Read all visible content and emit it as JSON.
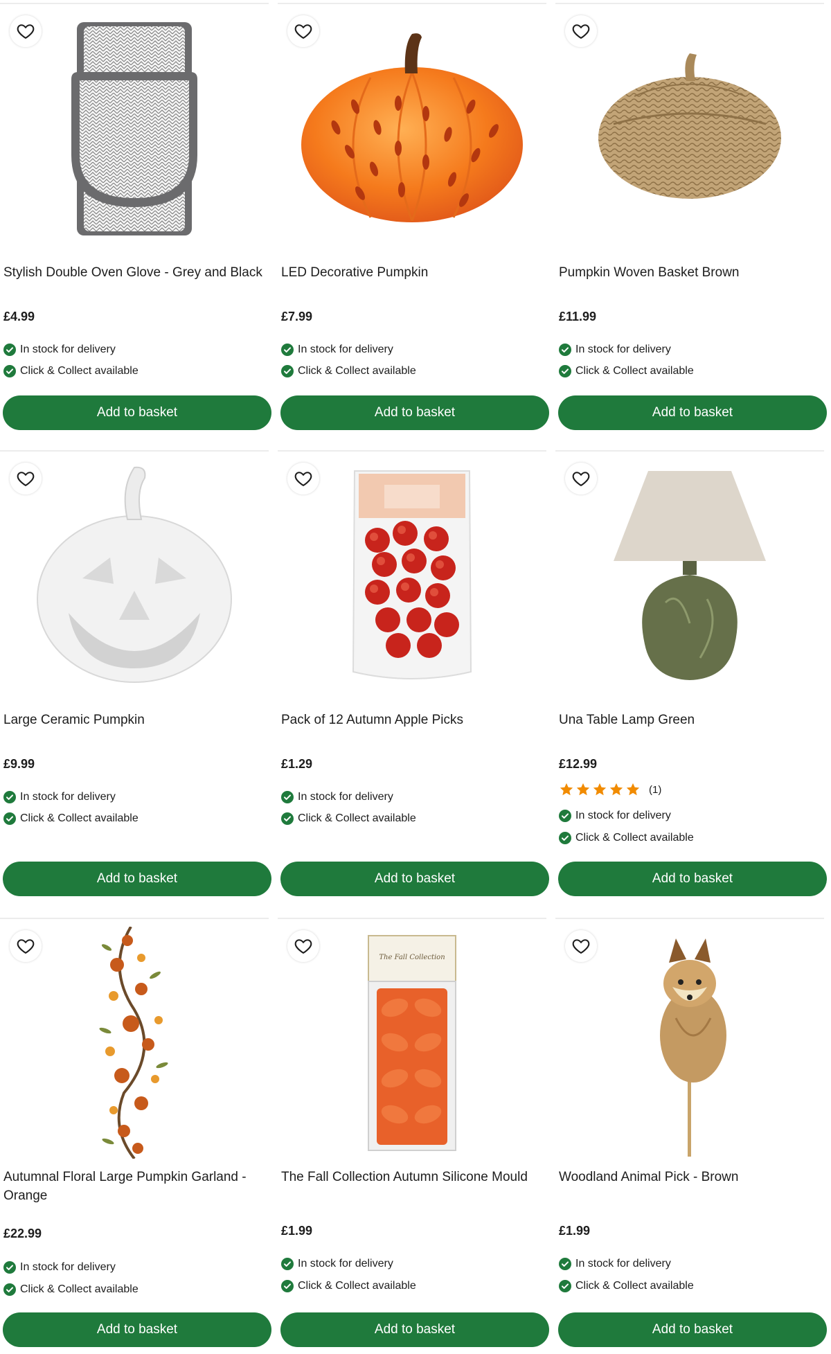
{
  "colors": {
    "accent": "#1f7a3c",
    "star": "#f18b00"
  },
  "icons": {
    "wishlist": "heart-outline-icon",
    "availability": "check-circle-icon",
    "rating": "star-icon"
  },
  "products": [
    {
      "title": "Stylish Double Oven Glove - Grey and Black",
      "price": "£4.99",
      "delivery": "In stock for delivery",
      "collect": "Click & Collect available",
      "button": "Add to basket"
    },
    {
      "title": "LED Decorative Pumpkin",
      "price": "£7.99",
      "delivery": "In stock for delivery",
      "collect": "Click & Collect available",
      "button": "Add to basket"
    },
    {
      "title": "Pumpkin Woven Basket Brown",
      "price": "£11.99",
      "delivery": "In stock for delivery",
      "collect": "Click & Collect available",
      "button": "Add to basket"
    },
    {
      "title": "Large Ceramic Pumpkin",
      "price": "£9.99",
      "delivery": "In stock for delivery",
      "collect": "Click & Collect available",
      "button": "Add to basket"
    },
    {
      "title": "Pack of 12 Autumn Apple Picks",
      "price": "£1.29",
      "delivery": "In stock for delivery",
      "collect": "Click & Collect available",
      "button": "Add to basket"
    },
    {
      "title": "Una Table Lamp Green",
      "price": "£12.99",
      "rating": 5,
      "rating_count": "(1)",
      "delivery": "In stock for delivery",
      "collect": "Click & Collect available",
      "button": "Add to basket"
    },
    {
      "title": "Autumnal Floral Large Pumpkin Garland - Orange",
      "price": "£22.99",
      "delivery": "In stock for delivery",
      "collect": "Click & Collect available",
      "button": "Add to basket"
    },
    {
      "title": "The Fall Collection Autumn Silicone Mould",
      "price": "£1.99",
      "delivery": "In stock for delivery",
      "collect": "Click & Collect available",
      "button": "Add to basket",
      "package_text": "The Fall Collection"
    },
    {
      "title": "Woodland Animal Pick - Brown",
      "price": "£1.99",
      "delivery": "In stock for delivery",
      "collect": "Click & Collect available",
      "button": "Add to basket"
    }
  ]
}
